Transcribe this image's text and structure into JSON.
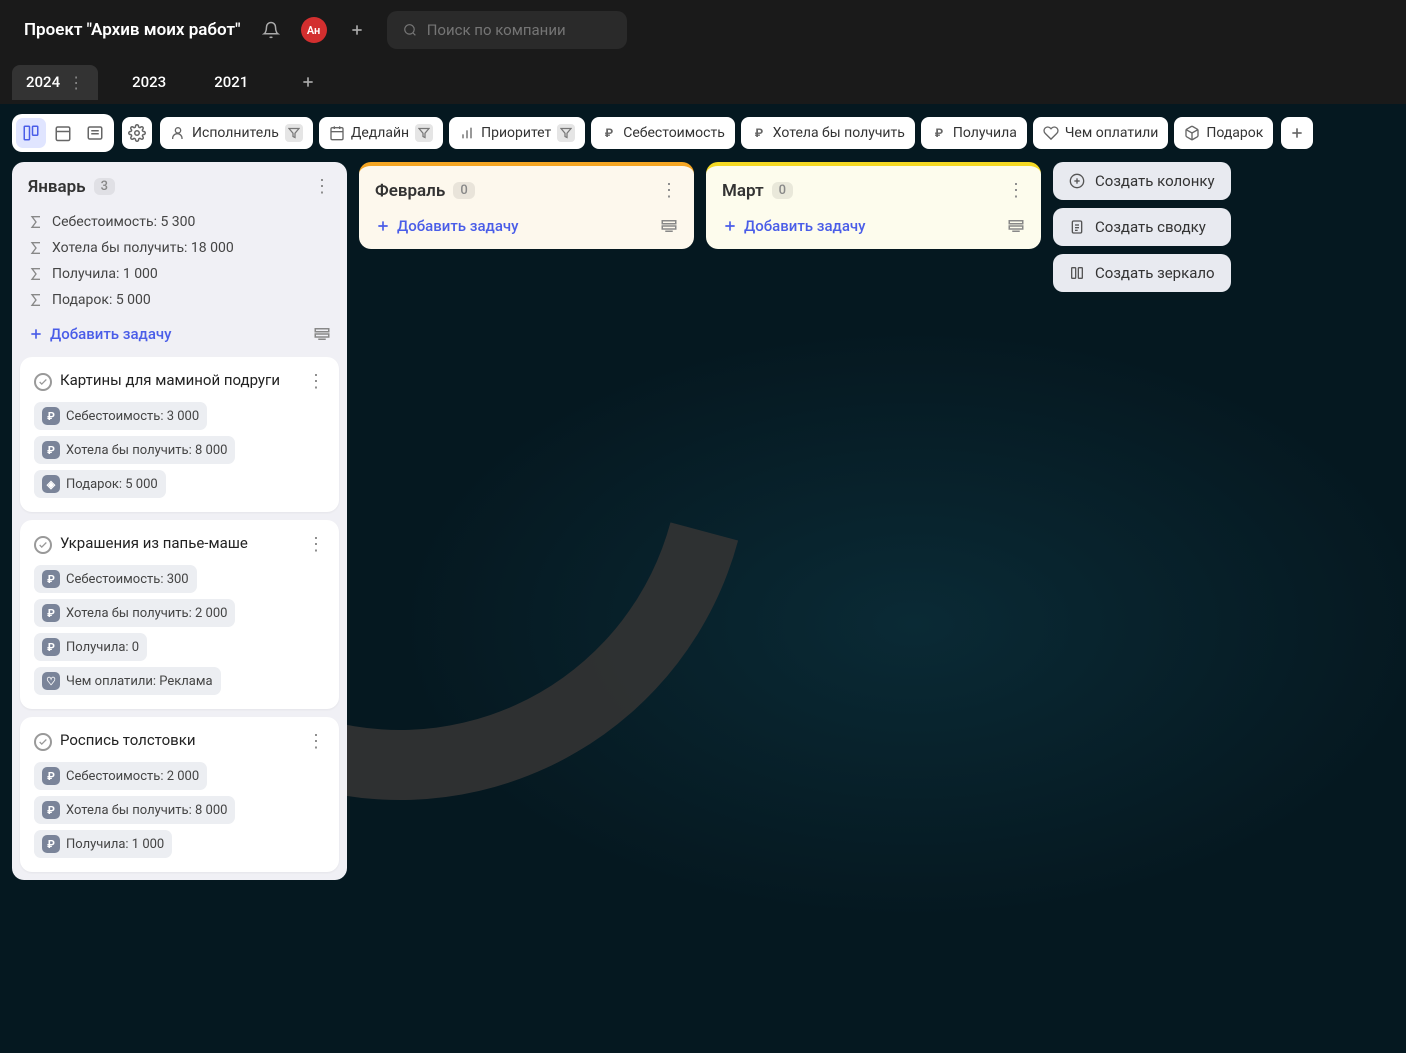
{
  "header": {
    "project_title": "Проект \"Архив моих работ\"",
    "avatar_text": "Ан",
    "search_placeholder": "Поиск по компании"
  },
  "tabs": [
    {
      "label": "2024",
      "active": true
    },
    {
      "label": "2023",
      "active": false
    },
    {
      "label": "2021",
      "active": false
    }
  ],
  "filters": [
    {
      "icon": "user",
      "label": "Исполнитель",
      "has_filter": true
    },
    {
      "icon": "calendar",
      "label": "Дедлайн",
      "has_filter": true
    },
    {
      "icon": "bars",
      "label": "Приоритет",
      "has_filter": true
    },
    {
      "icon": "ruble",
      "label": "Себестоимость",
      "has_filter": false
    },
    {
      "icon": "ruble",
      "label": "Хотела бы получить",
      "has_filter": false
    },
    {
      "icon": "ruble",
      "label": "Получила",
      "has_filter": false
    },
    {
      "icon": "heart",
      "label": "Чем оплатили",
      "has_filter": false
    },
    {
      "icon": "cube",
      "label": "Подарок",
      "has_filter": false
    }
  ],
  "side_actions": [
    {
      "icon": "plus-circle",
      "label": "Создать колонку"
    },
    {
      "icon": "clipboard",
      "label": "Создать сводку"
    },
    {
      "icon": "mirror",
      "label": "Создать зеркало"
    }
  ],
  "add_task_label": "Добавить задачу",
  "columns": [
    {
      "title": "Январь",
      "count": "3",
      "accent": "none",
      "summary": [
        {
          "icon": "sigma",
          "label": "Себестоимость: 5 300"
        },
        {
          "icon": "sigma",
          "label": "Хотела бы получить: 18 000"
        },
        {
          "icon": "sigma",
          "label": "Получила: 1 000"
        },
        {
          "icon": "sigma",
          "label": "Подарок: 5 000"
        }
      ],
      "cards": [
        {
          "title": "Картины для маминой подруги",
          "tags": [
            {
              "icon": "ruble",
              "label": "Себестоимость: 3 000"
            },
            {
              "icon": "ruble",
              "label": "Хотела бы получить: 8 000"
            },
            {
              "icon": "cube",
              "label": "Подарок: 5 000"
            }
          ]
        },
        {
          "title": "Украшения из папье-маше",
          "tags": [
            {
              "icon": "ruble",
              "label": "Себестоимость: 300"
            },
            {
              "icon": "ruble",
              "label": "Хотела бы получить: 2 000"
            },
            {
              "icon": "ruble",
              "label": "Получила: 0"
            },
            {
              "icon": "heart",
              "label": "Чем оплатили: Реклама"
            }
          ]
        },
        {
          "title": "Роспись толстовки",
          "tags": [
            {
              "icon": "ruble",
              "label": "Себестоимость: 2 000"
            },
            {
              "icon": "ruble",
              "label": "Хотела бы получить: 8 000"
            },
            {
              "icon": "ruble",
              "label": "Получила: 1 000"
            }
          ]
        }
      ]
    },
    {
      "title": "Февраль",
      "count": "0",
      "accent": "orange",
      "summary": [],
      "cards": []
    },
    {
      "title": "Март",
      "count": "0",
      "accent": "yellow",
      "summary": [],
      "cards": []
    }
  ]
}
